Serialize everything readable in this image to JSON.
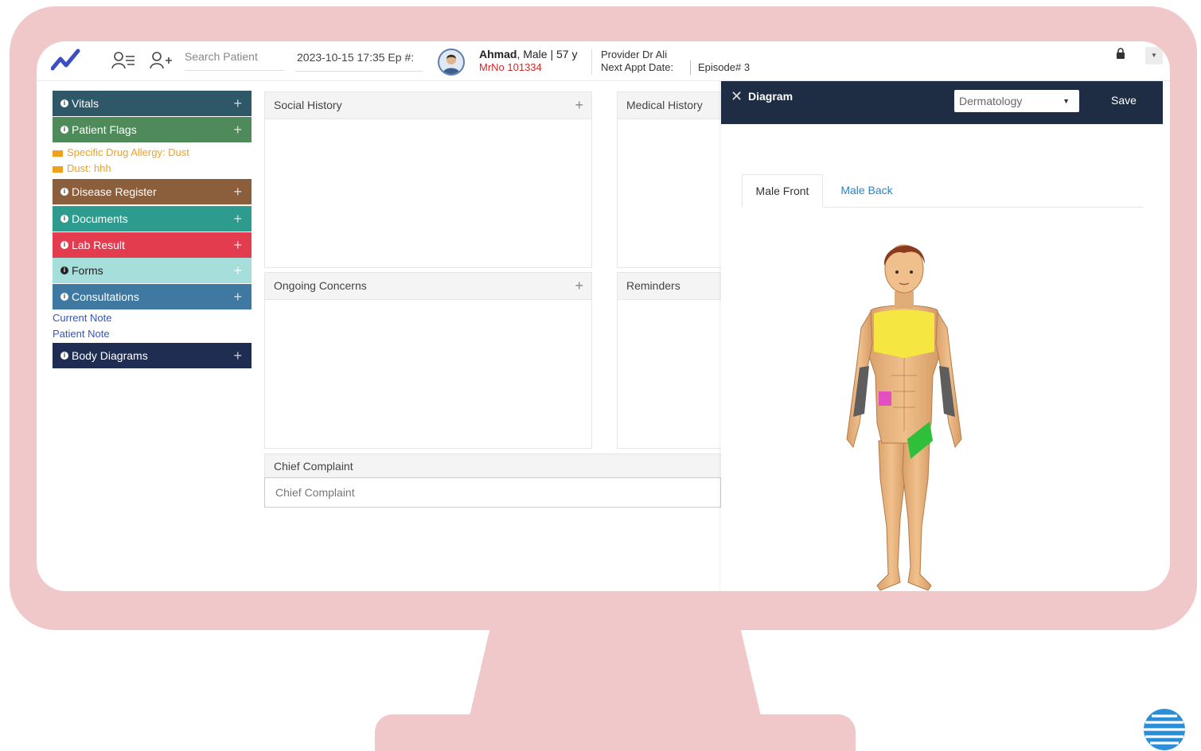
{
  "header": {
    "search_placeholder": "Search Patient",
    "datetime_label": "2023-10-15 17:35 Ep #:",
    "patient_name": "Ahmad",
    "patient_details": ", Male | 57 y",
    "mrno": "MrNo 101334",
    "provider": "Provider   Dr Ali",
    "next_appt": "Next Appt Date:",
    "episode": "Episode# 3"
  },
  "sidebar": {
    "items": [
      {
        "label": "Vitals",
        "color": "#2e5868"
      },
      {
        "label": "Patient Flags",
        "color": "#4e8a5a"
      },
      {
        "label": "Disease Register",
        "color": "#8b5e3c"
      },
      {
        "label": "Documents",
        "color": "#2e9b8f"
      },
      {
        "label": "Lab Result",
        "color": "#e23c4e"
      },
      {
        "label": "Forms",
        "color": "#a6dedc"
      },
      {
        "label": "Consultations",
        "color": "#3f78a0"
      },
      {
        "label": "Body Diagrams",
        "color": "#1f2d52"
      }
    ],
    "flags": [
      "Specific Drug Allergy: Dust",
      "Dust: hhh"
    ],
    "links": [
      "Current Note",
      "Patient Note"
    ]
  },
  "panels": {
    "social_history": "Social History",
    "medical_history": "Medical History",
    "ongoing_concerns": "Ongoing Concerns",
    "reminders": "Reminders",
    "chief_complaint": "Chief Complaint",
    "chief_complaint_placeholder": "Chief Complaint"
  },
  "diagram": {
    "title": "Diagram",
    "select_value": "Dermatology",
    "save_label": "Save",
    "tabs": [
      "Male Front",
      "Male Back"
    ],
    "active_tab": "Male Front",
    "marks": [
      {
        "region": "chest",
        "color": "#f5e642"
      },
      {
        "region": "forearms",
        "color": "#5e5e5e"
      },
      {
        "region": "right-hip",
        "color": "#e34fc0"
      },
      {
        "region": "left-thigh",
        "color": "#2fbf3a"
      }
    ]
  }
}
